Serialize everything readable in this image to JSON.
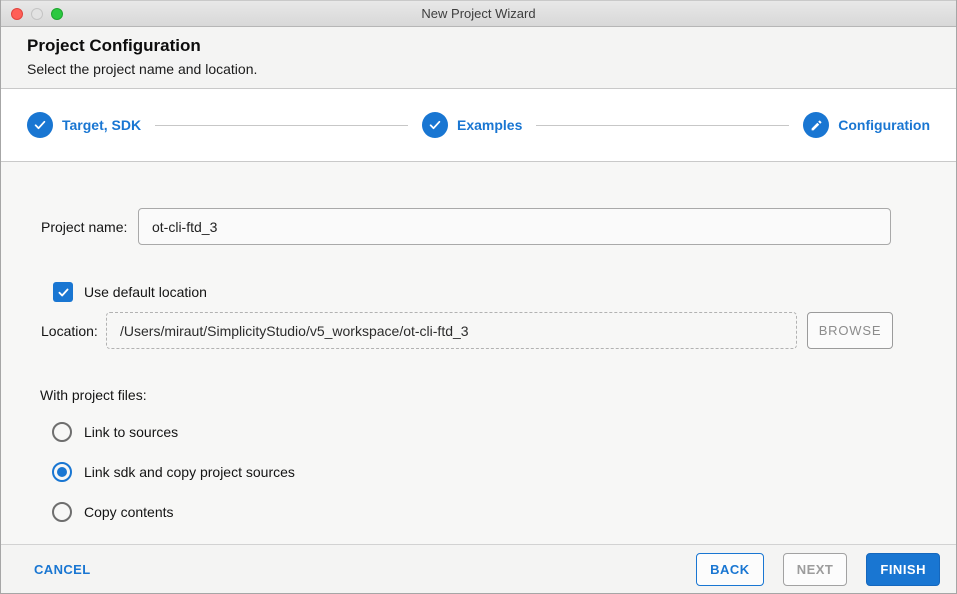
{
  "window": {
    "title": "New Project Wizard"
  },
  "header": {
    "title": "Project Configuration",
    "subtitle": "Select the project name and location."
  },
  "stepper": {
    "steps": [
      {
        "label": "Target, SDK",
        "icon": "check-icon",
        "state": "complete"
      },
      {
        "label": "Examples",
        "icon": "check-icon",
        "state": "complete"
      },
      {
        "label": "Configuration",
        "icon": "pencil-icon",
        "state": "active"
      }
    ]
  },
  "form": {
    "project_name": {
      "label": "Project name:",
      "value": "ot-cli-ftd_3"
    },
    "use_default_location": {
      "label": "Use default location",
      "checked": true
    },
    "location": {
      "label": "Location:",
      "value": "/Users/miraut/SimplicityStudio/v5_workspace/ot-cli-ftd_3",
      "browse_label": "BROWSE",
      "browse_enabled": false
    },
    "with_project_files": {
      "label": "With project files:",
      "options": [
        {
          "label": "Link to sources",
          "selected": false
        },
        {
          "label": "Link sdk and copy project sources",
          "selected": true
        },
        {
          "label": "Copy contents",
          "selected": false
        }
      ]
    }
  },
  "footer": {
    "cancel_label": "CANCEL",
    "back_label": "BACK",
    "next_label": "NEXT",
    "next_enabled": false,
    "finish_label": "FINISH"
  },
  "colors": {
    "accent": "#1976d2",
    "traffic_red": "#ff5f57",
    "traffic_green": "#2bc840",
    "disabled_text": "#9c9c9c"
  }
}
